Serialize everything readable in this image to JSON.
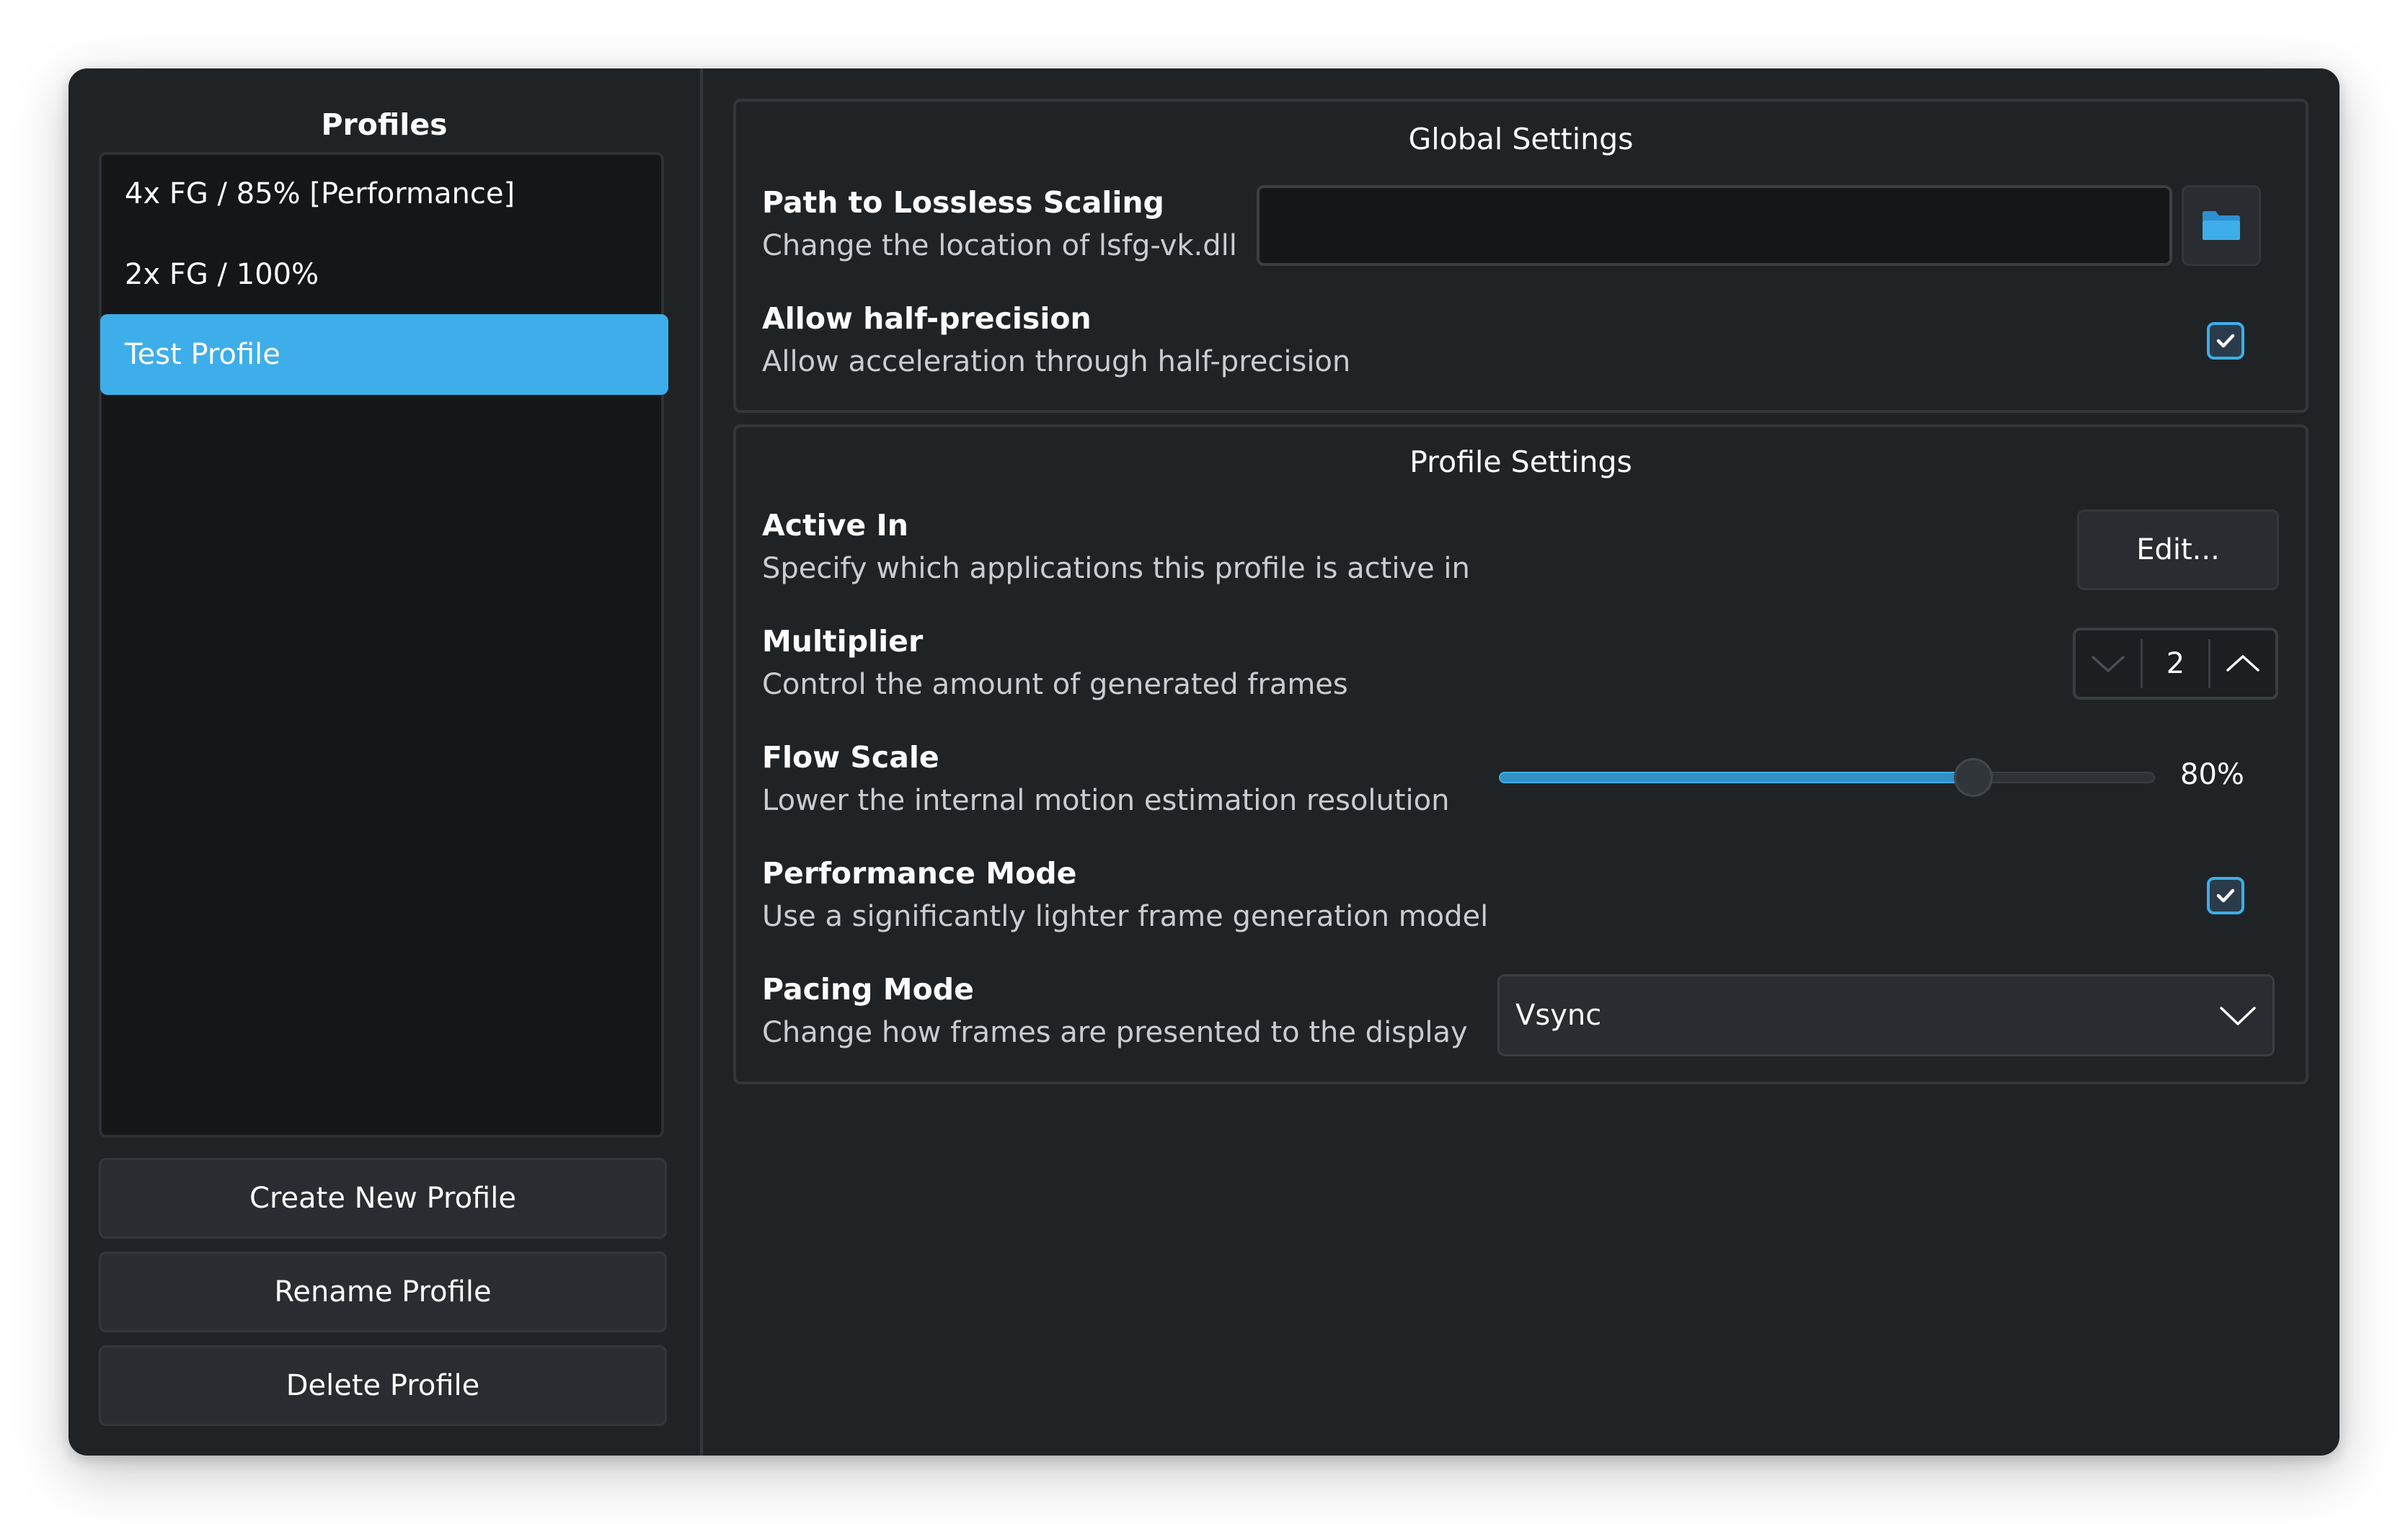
{
  "profiles": {
    "title": "Profiles",
    "items": [
      {
        "label": "4x FG / 85% [Performance]",
        "selected": false
      },
      {
        "label": "2x FG / 100%",
        "selected": false
      },
      {
        "label": "Test Profile",
        "selected": true
      }
    ],
    "buttons": {
      "create": "Create New Profile",
      "rename": "Rename Profile",
      "delete": "Delete Profile"
    }
  },
  "global_settings": {
    "title": "Global Settings",
    "path": {
      "title": "Path to Lossless Scaling",
      "description": "Change the location of lsfg-vk.dll",
      "value": "",
      "browse_icon": "folder-icon"
    },
    "half_precision": {
      "title": "Allow half-precision",
      "description": "Allow acceleration through half-precision",
      "checked": true
    }
  },
  "profile_settings": {
    "title": "Profile Settings",
    "active_in": {
      "title": "Active In",
      "description": "Specify which applications this profile is active in",
      "button": "Edit..."
    },
    "multiplier": {
      "title": "Multiplier",
      "description": "Control the amount of generated frames",
      "value": "2"
    },
    "flow_scale": {
      "title": "Flow Scale",
      "description": "Lower the internal motion estimation resolution",
      "value": 0.8,
      "value_label": "80%"
    },
    "performance_mode": {
      "title": "Performance Mode",
      "description": "Use a significantly lighter frame generation model",
      "checked": true
    },
    "pacing_mode": {
      "title": "Pacing Mode",
      "description": "Change how frames are presented to the display",
      "selected": "Vsync"
    }
  },
  "colors": {
    "accent": "#3daee9",
    "window_bg": "#202326",
    "list_bg": "#141618"
  }
}
